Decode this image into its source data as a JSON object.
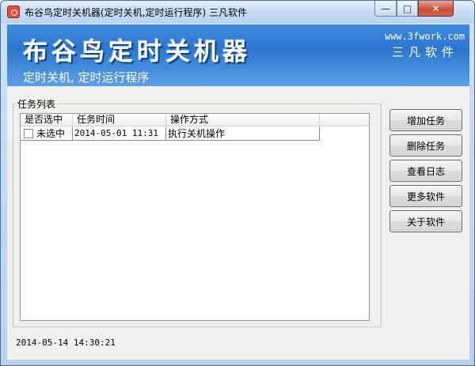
{
  "window": {
    "title": "布谷鸟定时关机器(定时关机,定时运行程序) 三凡软件",
    "min_symbol": "—",
    "max_symbol": "□",
    "close_symbol": "✕"
  },
  "banner": {
    "title": "布谷鸟定时关机器",
    "subtitle": "定时关机, 定时运行程序",
    "url": "www.3fwork.com",
    "company": "三凡软件",
    "color": "#2c76cf"
  },
  "task_list": {
    "group_label": "任务列表",
    "columns": [
      "是否选中",
      "任务时间",
      "操作方式",
      ""
    ],
    "rows": [
      {
        "selected_label": "未选中",
        "checked": false,
        "time": "2014-05-01 11:31",
        "action": "执行关机操作"
      }
    ]
  },
  "buttons": {
    "add": "增加任务",
    "delete": "删除任务",
    "log": "查看日志",
    "more": "更多软件",
    "about": "关于软件"
  },
  "status": {
    "current_time": "2014-05-14 14:30:21"
  }
}
